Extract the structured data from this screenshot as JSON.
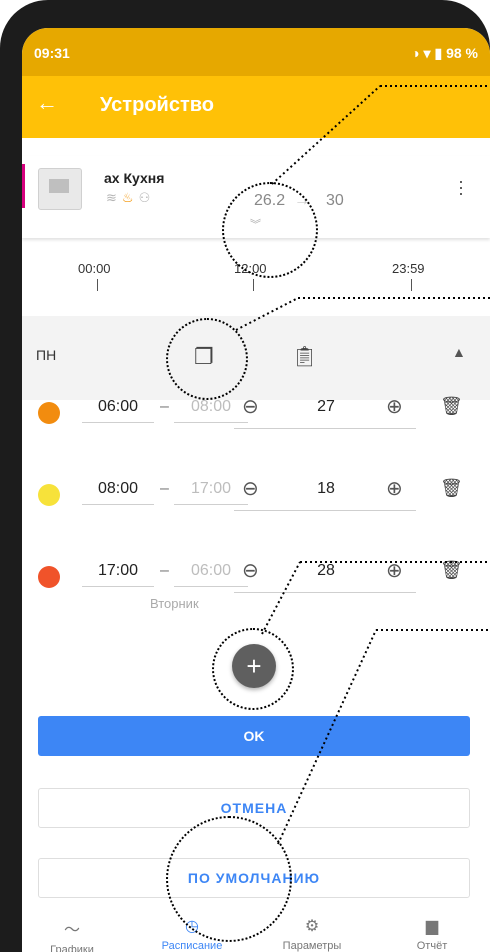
{
  "status": {
    "time": "09:31",
    "battery": "98 %"
  },
  "appbar": {
    "back_icon": "←",
    "title": "Устройство"
  },
  "device": {
    "name": "ах Кухня",
    "current_temp": "26.2",
    "arrow": "→",
    "target_temp": "30",
    "expand_icon": "»"
  },
  "timeline": {
    "start": "00:00",
    "mid": "12:00",
    "end": "23:59"
  },
  "day": {
    "label": "ПН"
  },
  "slots": [
    {
      "start": "06:00",
      "end": "08:00",
      "temp": "27",
      "color": "#f28c0f"
    },
    {
      "start": "08:00",
      "end": "17:00",
      "temp": "18",
      "color": "#f7e23a"
    },
    {
      "start": "17:00",
      "end": "06:00",
      "temp": "28",
      "color": "#f0532a",
      "sub": "Вторник"
    }
  ],
  "buttons": {
    "add": "+",
    "ok": "OK",
    "cancel": "ОТМЕНА",
    "default": "ПО УМОЛЧАНИЮ"
  },
  "nav": {
    "graphs": "Графики",
    "schedule": "Расписание",
    "params": "Параметры",
    "report": "Отчёт"
  }
}
